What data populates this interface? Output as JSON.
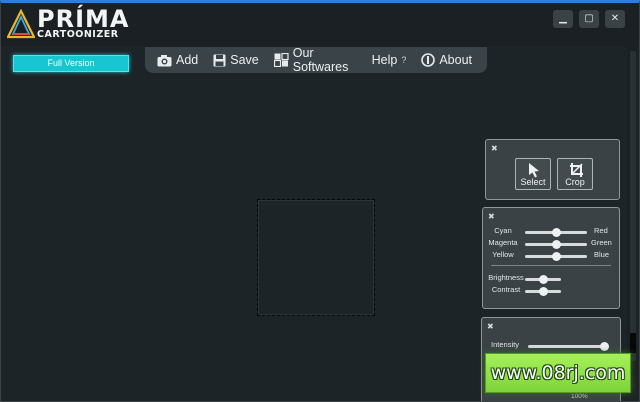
{
  "app": {
    "brand": "PRÍMA",
    "subtitle": "CARTOONIZER"
  },
  "window_controls": {
    "minimize": "▁",
    "maximize": "▢",
    "close": "✕"
  },
  "full_version_label": "Full Version",
  "toolbar": {
    "add": "Add",
    "save": "Save",
    "our_softwares": "Our Softwares",
    "help": "Help",
    "help_hint": "?",
    "about": "About"
  },
  "tools": {
    "select": "Select",
    "crop": "Crop"
  },
  "color_balance": [
    {
      "left": "Cyan",
      "right": "Red",
      "value": 0.5
    },
    {
      "left": "Magenta",
      "right": "Green",
      "value": 0.5
    },
    {
      "left": "Yellow",
      "right": "Blue",
      "value": 0.5
    }
  ],
  "adjustments": [
    {
      "label": "Brightness",
      "value": 0.5
    },
    {
      "label": "Contrast",
      "value": 0.5
    }
  ],
  "intensity": {
    "label": "Intensity",
    "value": 0.98
  },
  "zoom_label": "100%",
  "watermark": "www.08rj.com",
  "icons": [
    "camera-icon",
    "floppy-disk-icon",
    "software-icon",
    "info-icon",
    "cursor-icon",
    "crop-icon",
    "pin-icon"
  ],
  "colors": {
    "accent": "#17c6d1",
    "titlebar_border": "#2f7fd8",
    "panel": "#3a4246",
    "background": "#1d2427"
  }
}
